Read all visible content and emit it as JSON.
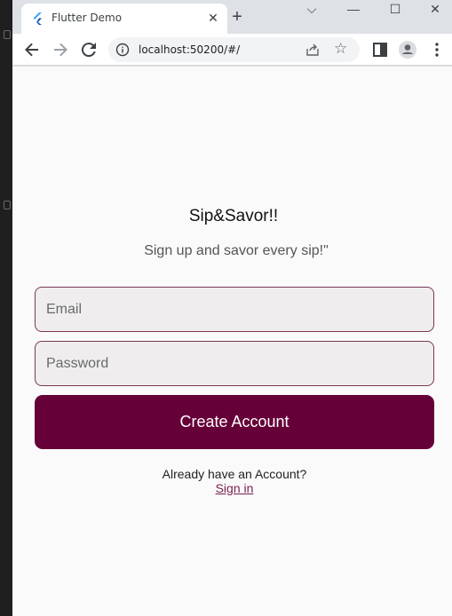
{
  "browser": {
    "tab_title": "Flutter Demo",
    "tab_close_glyph": "✕",
    "new_tab_glyph": "+",
    "url": "localhost:50200/#/",
    "icons": [
      "flutter-icon",
      "back-icon",
      "forward-icon",
      "reload-icon",
      "info-icon",
      "share-icon",
      "star-icon",
      "sidepanel-icon",
      "profile-icon",
      "menu-icon"
    ]
  },
  "window_controls": {
    "dropdown": "⌵",
    "minimize": "—",
    "maximize": "☐",
    "close": "✕"
  },
  "app": {
    "title": "Sip&Savor!!",
    "subtitle": "Sign up  and savor every sip!\"",
    "email_placeholder": "Email",
    "password_placeholder": "Password",
    "create_account_label": "Create Account",
    "already_prompt": "Already have an Account?",
    "sign_in_label": "Sign in"
  },
  "colors": {
    "primary": "#660038",
    "field_border": "#7c3557",
    "field_fill": "#efeded",
    "link": "#7a1f4f",
    "page_bg": "#fafafa"
  }
}
